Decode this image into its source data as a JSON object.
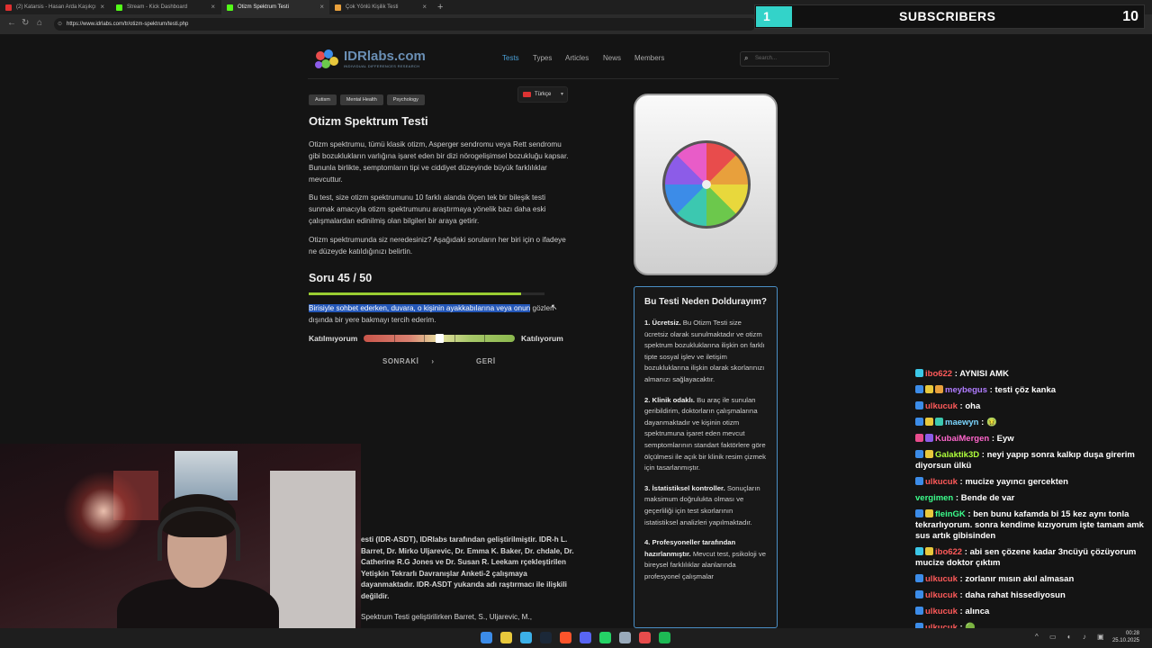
{
  "browser": {
    "tabs": [
      {
        "label": "(2) Katarsis - Hasan Arda Kaşıkçı",
        "fav_color": "#e03030",
        "active": false
      },
      {
        "label": "Stream - Kick Dashboard",
        "fav_color": "#53fc18",
        "active": false
      },
      {
        "label": "Otizm Spektrum Testi",
        "fav_color": "#53fc18",
        "active": true
      },
      {
        "label": "Çok Yönlü Kişilik Testi",
        "fav_color": "#e8a03c",
        "active": false
      }
    ],
    "new_tab": "+",
    "url": "https://www.idrlabs.com/tr/otizm-spektrum/testi.php"
  },
  "overlay": {
    "count": "1",
    "label": "SUBSCRIBERS",
    "goal": "10"
  },
  "site": {
    "logo": "IDRlabs.com",
    "logo_sub": "INDIVIDUAL DIFFERENCES RESEARCH",
    "nav": [
      "Tests",
      "Types",
      "Articles",
      "News",
      "Members"
    ],
    "search_placeholder": "Search...",
    "tags": [
      "Autism",
      "Mental Health",
      "Psychology"
    ],
    "language": "Türkçe"
  },
  "content": {
    "title": "Otizm Spektrum Testi",
    "paragraphs": [
      "Otizm spektrumu, tümü klasik otizm, Asperger sendromu veya Rett sendromu gibi bozuklukların varlığına işaret eden bir dizi nörogelişimsel bozukluğu kapsar. Bununla birlikte, semptomların tipi ve ciddiyet düzeyinde büyük farklılıklar mevcuttur.",
      "Bu test, size otizm spektrumunu 10 farklı alanda ölçen tek bir bileşik testi sunmak amacıyla otizm spektrumunu araştırmaya yönelik bazı daha eski çalışmalardan edinilmiş olan bilgileri bir araya getirir.",
      "Otizm spektrumunda siz neredesiniz? Aşağıdaki soruların her biri için o ifadeye ne düzeyde katıldığınızı belirtin."
    ],
    "question_number": "Soru 45 / 50",
    "progress": 0.9,
    "question_highlighted": "Birisiyle sohbet ederken, duvara, o kişinin ayakkabılarına veya onun",
    "question_rest": " gözleri dışında bir yere bakmayı tercih ederim.",
    "scale_left": "Katılmıyorum",
    "scale_right": "Katılıyorum",
    "scale_value": 0.5,
    "next": "SONRAKİ",
    "next_arrow": "›",
    "back": "GERİ"
  },
  "why": {
    "title": "Bu Testi Neden Doldurayım?",
    "items": [
      {
        "head": "1. Ücretsiz.",
        "body": " Bu Otizm Testi size ücretsiz olarak sunulmaktadır ve otizm spektrum bozukluklarına ilişkin on farklı tipte sosyal işlev ve iletişim bozukluklarına ilişkin olarak skorlarınızı almanızı sağlayacaktır."
      },
      {
        "head": "2. Klinik odaklı.",
        "body": " Bu araç ile sunulan geribildirim, doktorların çalışmalarına dayanmaktadır ve kişinin otizm spektrumuna işaret eden mevcut semptomlarının standart faktörlere göre ölçülmesi ile açık bir klinik resim çizmek için tasarlanmıştır."
      },
      {
        "head": "3. İstatistiksel kontroller.",
        "body": " Sonuçların maksimum doğrulukta olması ve geçerliliği için test skorlarının istatistiksel analizleri yapılmaktadır."
      },
      {
        "head": "4. Profesyoneller tarafından hazırlanmıştır.",
        "body": " Mevcut test, psikoloji ve bireysel farklılıklar alanlarında profesyonel çalışmalar"
      }
    ]
  },
  "lower": {
    "text": "esti (IDR-ASDT), IDRlabs tarafından geliştirilmiştir. IDR-h L. Barret, Dr. Mirko Uljarevic, Dr. Emma K. Baker, Dr. chdale, Dr. Catherine R.G Jones ve Dr. Susan R. Leekam rçekleştirilen Yetişkin Tekrarlı Davranışlar Anketi-2 çalışmaya dayanmaktadır. IDR-ASDT yukarıda adı raştırmacı ile ilişkili değildir.",
    "text2": "Spektrum Testi geliştirilirken Barret, S., Uljarevic, M.,"
  },
  "chat": [
    {
      "user": "ibo622",
      "color": "#ff5a5a",
      "msg": "AYNISI AMK",
      "badges": [
        "#3cc8e8"
      ]
    },
    {
      "user": "meybegus",
      "color": "#b07cff",
      "msg": "testi çöz kanka",
      "badges": [
        "#3c8ce8",
        "#e8c83c",
        "#e8a03c"
      ]
    },
    {
      "user": "ulkucuk",
      "color": "#ff5a5a",
      "msg": "oha",
      "badges": [
        "#3c8ce8"
      ]
    },
    {
      "user": "maewyn",
      "color": "#7cd6ff",
      "msg": "🤢",
      "badges": [
        "#3c8ce8",
        "#e8c83c",
        "#3cc8b0"
      ]
    },
    {
      "user": "KubaiMergen",
      "color": "#ff66cc",
      "msg": "Eyw",
      "badges": [
        "#e84c8c",
        "#8c5ce8"
      ]
    },
    {
      "user": "Galaktik3D",
      "color": "#b0ff3c",
      "msg": "neyi yapıp sonra kalkıp duşa girerim diyorsun ülkü",
      "badges": [
        "#3c8ce8",
        "#e8c83c"
      ]
    },
    {
      "user": "ulkucuk",
      "color": "#ff5a5a",
      "msg": "mucize yayıncı gercekten",
      "badges": [
        "#3c8ce8"
      ]
    },
    {
      "user": "vergimen",
      "color": "#3cff8c",
      "msg": "Bende de var",
      "badges": []
    },
    {
      "user": "fleinGK",
      "color": "#3cff8c",
      "msg": "ben bunu kafamda bi 15 kez aynı tonla tekrarlıyorum. sonra kendime kızıyorum işte tamam amk sus artık gibisinden",
      "badges": [
        "#3c8ce8",
        "#e8c83c"
      ]
    },
    {
      "user": "ibo622",
      "color": "#ff5a5a",
      "msg": "abi sen çözene kadar 3ncüyü çözüyorum mucize doktor çıktım",
      "badges": [
        "#3cc8e8",
        "#e8c83c"
      ]
    },
    {
      "user": "ulkucuk",
      "color": "#ff5a5a",
      "msg": "zorlanır mısın akıl almasan",
      "badges": [
        "#3c8ce8"
      ]
    },
    {
      "user": "ulkucuk",
      "color": "#ff5a5a",
      "msg": "daha rahat hissediyosun",
      "badges": [
        "#3c8ce8"
      ]
    },
    {
      "user": "ulkucuk",
      "color": "#ff5a5a",
      "msg": "alınca",
      "badges": [
        "#3c8ce8"
      ]
    },
    {
      "user": "ulkucuk",
      "color": "#ff5a5a",
      "msg": "🟢",
      "badges": [
        "#3c8ce8"
      ]
    }
  ],
  "taskbar": {
    "time": "00:28",
    "date": "25.10.2025",
    "app_icons": [
      "windows-start-icon",
      "file-explorer-icon",
      "edge-icon",
      "steam-icon",
      "brave-icon",
      "discord-icon",
      "whatsapp-icon",
      "settings-icon",
      "davinci-icon",
      "spotify-icon"
    ],
    "app_colors": [
      "#3c8ce8",
      "#e8c83c",
      "#3cb0e8",
      "#1b2838",
      "#fb542b",
      "#5865f2",
      "#25d366",
      "#9ab",
      "#e84c4c",
      "#1db954"
    ]
  }
}
